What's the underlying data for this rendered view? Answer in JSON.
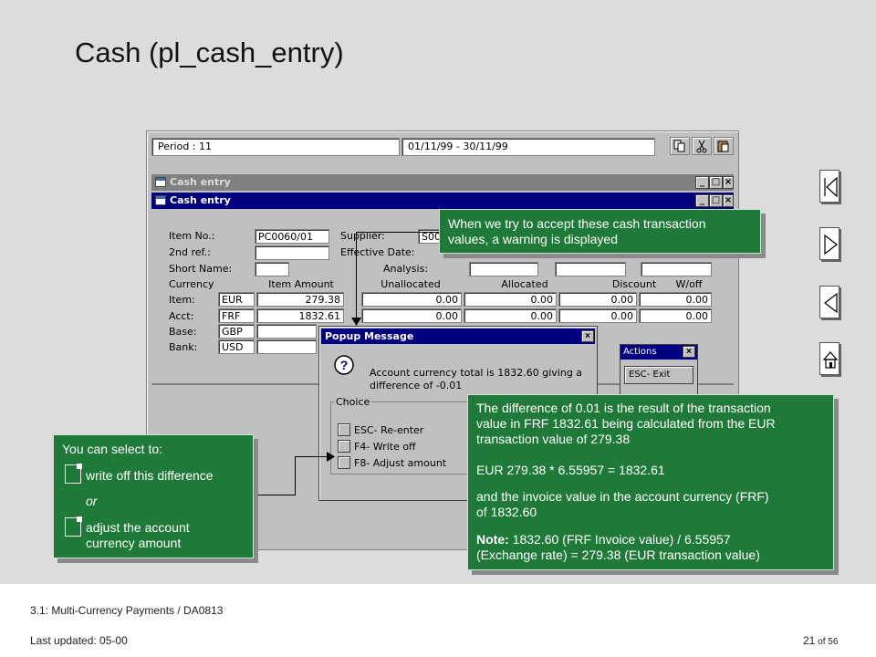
{
  "slide": {
    "title": "Cash (pl_cash_entry)",
    "footer_course": "3.1: Multi-Currency Payments / DA0813",
    "footer_updated": "Last updated:  05-00",
    "footer_page": "21",
    "footer_of": " of 56"
  },
  "app": {
    "period_label": "Period : 11",
    "period_range": "01/11/99 - 30/11/99",
    "window_title_back": "Cash entry",
    "window_title": "Cash entry"
  },
  "form": {
    "item_no_label": "Item No.:",
    "item_no_value": "PC0060/01",
    "second_ref_label": "2nd ref.:",
    "short_name_label": "Short Name:",
    "supplier_label": "Supplier:",
    "supplier_value": "S00",
    "effective_date_label": "Effective Date:",
    "analysis_label": "Analysis:",
    "currency_label": "Currency",
    "item_amount_header": "Item Amount",
    "unallocated_header": "Unallocated",
    "allocated_header": "Allocated",
    "discount_header": "Discount",
    "woff_header": "W/off",
    "rows": [
      {
        "label": "Item:",
        "currency": "EUR",
        "amount": "279.38",
        "unallocated": "0.00",
        "allocated": "0.00",
        "discount": "0.00",
        "woff": "0.00"
      },
      {
        "label": "Acct:",
        "currency": "FRF",
        "amount": "1832.61",
        "unallocated": "0.00",
        "allocated": "0.00",
        "discount": "0.00",
        "woff": "0.00"
      },
      {
        "label": "Base:",
        "currency": "GBP"
      },
      {
        "label": "Bank:",
        "currency": "USD"
      }
    ]
  },
  "popup": {
    "title": "Popup Message",
    "message_line1": "Account currency total is 1832.60 giving a",
    "message_line2": "difference of -0.01",
    "choice_label": "Choice",
    "options": [
      "ESC- Re-enter",
      "F4- Write off",
      "F8- Adjust amount"
    ]
  },
  "actions": {
    "title": "Actions",
    "exit_label": "ESC- Exit"
  },
  "callouts": {
    "top_line1": "When we try to accept these cash transaction",
    "top_line2": "values, a warning is displayed",
    "left_intro": "You can select to:",
    "left_opt1": "write off this difference",
    "left_or": "or",
    "left_opt2_line1": "adjust the account",
    "left_opt2_line2": "currency amount",
    "right_p1_line1": "The difference of 0.01 is the result of the transaction",
    "right_p1_line2": "value in FRF 1832.61 being calculated from the EUR",
    "right_p1_line3": "transaction value of 279.38",
    "right_p2": "EUR 279.38 * 6.55957 = 1832.61",
    "right_p3_line1": "and the invoice value in the account currency (FRF)",
    "right_p3_line2": "of 1832.60",
    "right_note_label": "Note:",
    "right_note_line1": " 1832.60 (FRF Invoice value) / 6.55957",
    "right_note_line2": "(Exchange rate) = 279.38 (EUR transaction value)"
  }
}
